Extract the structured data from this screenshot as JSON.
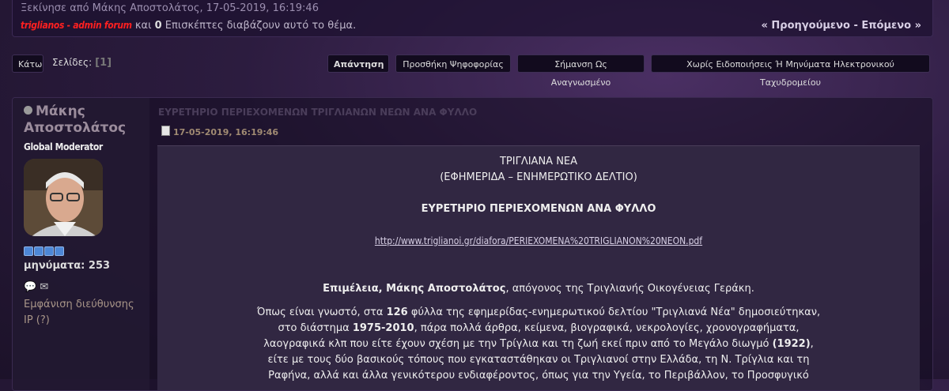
{
  "topic_info": {
    "started_by": "Ξεκίνησε από Μάκης Αποστολάτος, 17-05-2019, 16:19:46",
    "viewer_user": "triglianos - admin forum",
    "viewer_prefix": " και ",
    "viewer_count": "0",
    "viewer_suffix": " Επισκέπτες διαβάζουν αυτό το θέμα.",
    "prev_next": "« Προηγούμενο - Επόμενο »"
  },
  "toolbar": {
    "down_label": "Κάτω",
    "pages_label": "Σελίδες:",
    "page_number": "[1]",
    "reply_label": "Απάντηση",
    "add_poll_label": "Προσθήκη Ψηφοφορίας",
    "mark_unread_label": "Σήμανση Ως Αναγνωσμένο",
    "notify_label": "Χωρίς Ειδοποιήσεις Ή Μηνύματα Ηλεκτρονικού Ταχυδρομείου"
  },
  "poster": {
    "name": "Μάκης Αποστολάτος",
    "role": "Global Moderator",
    "stars_count": 4,
    "messages": "μηνύματα: 253",
    "show_ip": "Εμφάνιση διεύθυνσης IP (?)"
  },
  "post": {
    "subject": "ΕΥΡΕΤΗΡΙΟ ΠΕΡΙΕΧΟΜΕΝΩΝ ΤΡΙΓΛΙΑΝΩΝ ΝΕΩΝ ΑΝΑ ΦΥΛΛΟ",
    "date": "17-05-2019, 16:19:46",
    "line1": "ΤΡΙΓΛΙΑΝΑ ΝΕΑ",
    "line2": "(ΕΦΗΜΕΡΙΔΑ – ΕΝΗΜΕΡΩΤΙΚΟ ΔΕΛΤΙΟ)",
    "heading": "ΕΥΡΕΤΗΡΙΟ ΠΕΡΙΕΧΟΜΕΝΩΝ ΑΝΑ ΦΥΛΛΟ",
    "link": "http://www.triglianoi.gr/diafora/PERIEXOMENA%20TRIGLIANON%20NEON.pdf",
    "editor_bold": "Επιμέλεια, Μάκης Αποστολάτος",
    "editor_rest": ", απόγονος της Τριγλιανής Οικογένειας Γεράκη.",
    "para_l1a": "Όπως είναι γνωστό, στα ",
    "para_l1b": "126",
    "para_l1c": " φύλλα της εφημερίδας-ενημερωτικού δελτίου \"Τριγλιανά Νέα\" δημοσιεύτηκαν,",
    "para_l2a": "στο διάστημα ",
    "para_l2b": "1975-2010",
    "para_l2c": ", πάρα πολλά άρθρα, κείμενα, βιογραφικά, νεκρολογίες, χρονογραφήματα,",
    "para_l3a": "λαογραφικά κλπ που είτε έχουν σχέση με την Τρίγλια και τη ζωή εκεί πριν από το Μεγάλο διωγμό ",
    "para_l3b": "(1922)",
    "para_l3c": ",",
    "para_l4": "είτε με τους δύο βασικούς τόπους που εγκαταστάθηκαν οι Τριγλιανοί στην Ελλάδα, τη Ν. Τρίγλια και τη",
    "para_l5": "Ραφήνα, αλλά και άλλα γενικότερου ενδιαφέροντος, όπως για την Υγεία, το Περιβάλλον, το Προσφυγικό"
  }
}
